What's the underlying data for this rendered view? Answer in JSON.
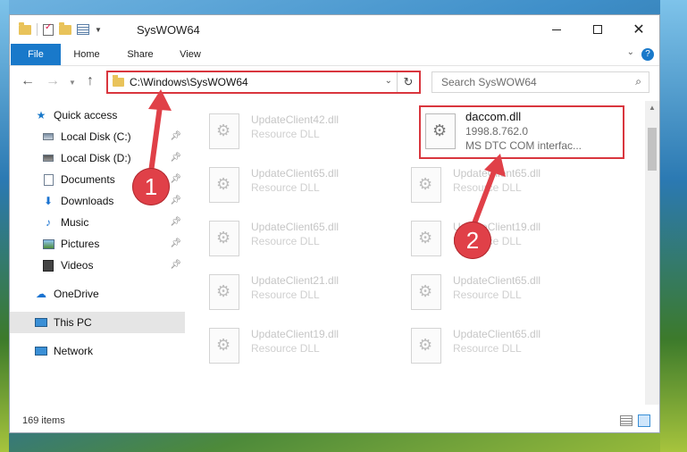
{
  "window": {
    "title": "SysWOW64",
    "controls": {
      "minimize": "minimize",
      "maximize": "maximize",
      "close": "✕"
    }
  },
  "ribbon": {
    "tabs": [
      "File",
      "Home",
      "Share",
      "View"
    ],
    "help": "?"
  },
  "nav": {
    "address": "C:\\Windows\\SysWOW64",
    "search_placeholder": "Search SysWOW64"
  },
  "sidebar": {
    "items": [
      {
        "label": "Quick access",
        "icon": "star-icon",
        "pinned": false
      },
      {
        "label": "Local Disk (C:)",
        "icon": "disk-icon",
        "pinned": true
      },
      {
        "label": "Local Disk (D:)",
        "icon": "disk-icon",
        "pinned": true
      },
      {
        "label": "Documents",
        "icon": "documents-icon",
        "pinned": true
      },
      {
        "label": "Downloads",
        "icon": "downloads-icon",
        "pinned": true
      },
      {
        "label": "Music",
        "icon": "music-icon",
        "pinned": true
      },
      {
        "label": "Pictures",
        "icon": "pictures-icon",
        "pinned": true
      },
      {
        "label": "Videos",
        "icon": "videos-icon",
        "pinned": true
      },
      {
        "label": "OneDrive",
        "icon": "onedrive-icon",
        "pinned": false
      },
      {
        "label": "This PC",
        "icon": "this-pc-icon",
        "pinned": false,
        "selected": true
      },
      {
        "label": "Network",
        "icon": "network-icon",
        "pinned": false
      }
    ]
  },
  "files": {
    "highlighted": {
      "name": "daccom.dll",
      "version": "1998.8.762.0",
      "description": "MS DTC COM interfac..."
    },
    "left_column": [
      {
        "name": "UpdateClient42.dll",
        "type": "Resource DLL"
      },
      {
        "name": "UpdateClient65.dll",
        "type": "Resource DLL"
      },
      {
        "name": "UpdateClient65.dll",
        "type": "Resource DLL"
      },
      {
        "name": "UpdateClient21.dll",
        "type": "Resource DLL"
      },
      {
        "name": "UpdateClient19.dll",
        "type": "Resource DLL"
      }
    ],
    "right_column": [
      {
        "name": "UpdateClient65.dll",
        "type": "Resource DLL"
      },
      {
        "name": "UpdateClient19.dll",
        "type": "Resource DLL"
      },
      {
        "name": "UpdateClient65.dll",
        "type": "Resource DLL"
      },
      {
        "name": "UpdateClient65.dll",
        "type": "Resource DLL"
      }
    ]
  },
  "status": {
    "item_count": "169 items"
  },
  "annotations": {
    "step1": "1",
    "step2": "2",
    "accent": "#e04048"
  }
}
